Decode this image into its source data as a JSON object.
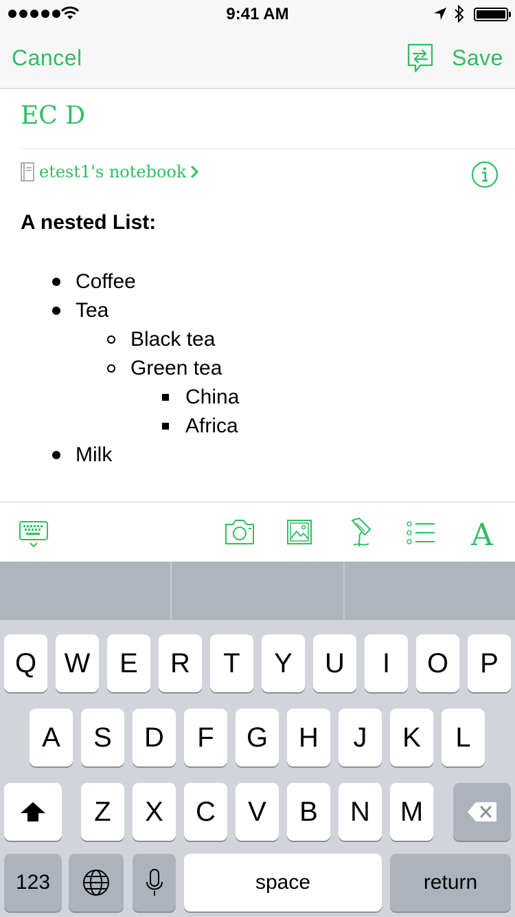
{
  "status_bar": {
    "time": "9:41 AM",
    "signal_icon": "signal-dots-icon",
    "wifi_icon": "wifi-icon",
    "location_icon": "location-arrow-icon",
    "bluetooth_icon": "bluetooth-icon",
    "battery_icon": "battery-full-icon",
    "battery_level": 1.0
  },
  "nav": {
    "cancel_label": "Cancel",
    "save_label": "Save",
    "share_icon": "share-chat-icon"
  },
  "note": {
    "title": "EC D",
    "notebook": "etest1's notebook",
    "notebook_icon": "notebook-icon",
    "chevron_icon": "chevron-right-icon",
    "info_icon": "info-icon",
    "heading": "A nested List:",
    "list": [
      {
        "text": "Coffee",
        "level": 1
      },
      {
        "text": "Tea",
        "level": 1
      },
      {
        "text": "Black tea",
        "level": 2
      },
      {
        "text": "Green tea",
        "level": 2
      },
      {
        "text": "China",
        "level": 3
      },
      {
        "text": "Africa",
        "level": 3
      },
      {
        "text": "Milk",
        "level": 1
      }
    ]
  },
  "toolbar": {
    "icons": [
      "keyboard-dismiss-icon",
      "camera-icon",
      "image-icon",
      "handwriting-icon",
      "list-icon",
      "font-icon"
    ],
    "font_label": "A"
  },
  "accent_color": "#2dbe60",
  "keyboard": {
    "row1": [
      "Q",
      "W",
      "E",
      "R",
      "T",
      "Y",
      "U",
      "I",
      "O",
      "P"
    ],
    "row2": [
      "A",
      "S",
      "D",
      "F",
      "G",
      "H",
      "J",
      "K",
      "L"
    ],
    "row3": [
      "Z",
      "X",
      "C",
      "V",
      "B",
      "N",
      "M"
    ],
    "numbers_label": "123",
    "space_label": "space",
    "return_label": "return",
    "shift_icon": "shift-icon",
    "delete_icon": "backspace-icon",
    "globe_icon": "globe-icon",
    "mic_icon": "microphone-icon"
  }
}
